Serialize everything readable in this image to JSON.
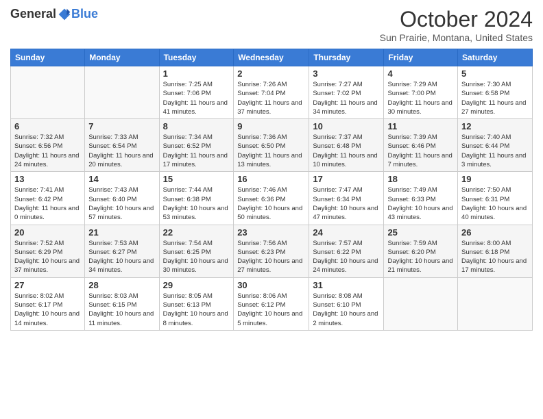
{
  "logo": {
    "general": "General",
    "blue": "Blue"
  },
  "title": "October 2024",
  "location": "Sun Prairie, Montana, United States",
  "days_of_week": [
    "Sunday",
    "Monday",
    "Tuesday",
    "Wednesday",
    "Thursday",
    "Friday",
    "Saturday"
  ],
  "weeks": [
    [
      {
        "day": "",
        "info": ""
      },
      {
        "day": "",
        "info": ""
      },
      {
        "day": "1",
        "info": "Sunrise: 7:25 AM\nSunset: 7:06 PM\nDaylight: 11 hours and 41 minutes."
      },
      {
        "day": "2",
        "info": "Sunrise: 7:26 AM\nSunset: 7:04 PM\nDaylight: 11 hours and 37 minutes."
      },
      {
        "day": "3",
        "info": "Sunrise: 7:27 AM\nSunset: 7:02 PM\nDaylight: 11 hours and 34 minutes."
      },
      {
        "day": "4",
        "info": "Sunrise: 7:29 AM\nSunset: 7:00 PM\nDaylight: 11 hours and 30 minutes."
      },
      {
        "day": "5",
        "info": "Sunrise: 7:30 AM\nSunset: 6:58 PM\nDaylight: 11 hours and 27 minutes."
      }
    ],
    [
      {
        "day": "6",
        "info": "Sunrise: 7:32 AM\nSunset: 6:56 PM\nDaylight: 11 hours and 24 minutes."
      },
      {
        "day": "7",
        "info": "Sunrise: 7:33 AM\nSunset: 6:54 PM\nDaylight: 11 hours and 20 minutes."
      },
      {
        "day": "8",
        "info": "Sunrise: 7:34 AM\nSunset: 6:52 PM\nDaylight: 11 hours and 17 minutes."
      },
      {
        "day": "9",
        "info": "Sunrise: 7:36 AM\nSunset: 6:50 PM\nDaylight: 11 hours and 13 minutes."
      },
      {
        "day": "10",
        "info": "Sunrise: 7:37 AM\nSunset: 6:48 PM\nDaylight: 11 hours and 10 minutes."
      },
      {
        "day": "11",
        "info": "Sunrise: 7:39 AM\nSunset: 6:46 PM\nDaylight: 11 hours and 7 minutes."
      },
      {
        "day": "12",
        "info": "Sunrise: 7:40 AM\nSunset: 6:44 PM\nDaylight: 11 hours and 3 minutes."
      }
    ],
    [
      {
        "day": "13",
        "info": "Sunrise: 7:41 AM\nSunset: 6:42 PM\nDaylight: 11 hours and 0 minutes."
      },
      {
        "day": "14",
        "info": "Sunrise: 7:43 AM\nSunset: 6:40 PM\nDaylight: 10 hours and 57 minutes."
      },
      {
        "day": "15",
        "info": "Sunrise: 7:44 AM\nSunset: 6:38 PM\nDaylight: 10 hours and 53 minutes."
      },
      {
        "day": "16",
        "info": "Sunrise: 7:46 AM\nSunset: 6:36 PM\nDaylight: 10 hours and 50 minutes."
      },
      {
        "day": "17",
        "info": "Sunrise: 7:47 AM\nSunset: 6:34 PM\nDaylight: 10 hours and 47 minutes."
      },
      {
        "day": "18",
        "info": "Sunrise: 7:49 AM\nSunset: 6:33 PM\nDaylight: 10 hours and 43 minutes."
      },
      {
        "day": "19",
        "info": "Sunrise: 7:50 AM\nSunset: 6:31 PM\nDaylight: 10 hours and 40 minutes."
      }
    ],
    [
      {
        "day": "20",
        "info": "Sunrise: 7:52 AM\nSunset: 6:29 PM\nDaylight: 10 hours and 37 minutes."
      },
      {
        "day": "21",
        "info": "Sunrise: 7:53 AM\nSunset: 6:27 PM\nDaylight: 10 hours and 34 minutes."
      },
      {
        "day": "22",
        "info": "Sunrise: 7:54 AM\nSunset: 6:25 PM\nDaylight: 10 hours and 30 minutes."
      },
      {
        "day": "23",
        "info": "Sunrise: 7:56 AM\nSunset: 6:23 PM\nDaylight: 10 hours and 27 minutes."
      },
      {
        "day": "24",
        "info": "Sunrise: 7:57 AM\nSunset: 6:22 PM\nDaylight: 10 hours and 24 minutes."
      },
      {
        "day": "25",
        "info": "Sunrise: 7:59 AM\nSunset: 6:20 PM\nDaylight: 10 hours and 21 minutes."
      },
      {
        "day": "26",
        "info": "Sunrise: 8:00 AM\nSunset: 6:18 PM\nDaylight: 10 hours and 17 minutes."
      }
    ],
    [
      {
        "day": "27",
        "info": "Sunrise: 8:02 AM\nSunset: 6:17 PM\nDaylight: 10 hours and 14 minutes."
      },
      {
        "day": "28",
        "info": "Sunrise: 8:03 AM\nSunset: 6:15 PM\nDaylight: 10 hours and 11 minutes."
      },
      {
        "day": "29",
        "info": "Sunrise: 8:05 AM\nSunset: 6:13 PM\nDaylight: 10 hours and 8 minutes."
      },
      {
        "day": "30",
        "info": "Sunrise: 8:06 AM\nSunset: 6:12 PM\nDaylight: 10 hours and 5 minutes."
      },
      {
        "day": "31",
        "info": "Sunrise: 8:08 AM\nSunset: 6:10 PM\nDaylight: 10 hours and 2 minutes."
      },
      {
        "day": "",
        "info": ""
      },
      {
        "day": "",
        "info": ""
      }
    ]
  ]
}
